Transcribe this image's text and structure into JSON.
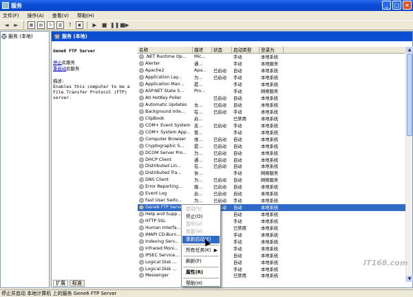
{
  "window": {
    "title": "服务"
  },
  "menubar": [
    "文件(F)",
    "操作(A)",
    "查看(V)",
    "帮助(H)"
  ],
  "tree": {
    "root_label": "服务 (本地)"
  },
  "panel": {
    "header": "服务 (本地)"
  },
  "description": {
    "service_name": "Gene6 FTP Server",
    "stop_link": "停止",
    "stop_suffix": "此服务",
    "restart_link": "重启动",
    "restart_suffix": "此服务",
    "desc_label": "描述:",
    "desc_text": "Enables this computer to be a File Transfer Protocol (FTP) server."
  },
  "table": {
    "columns": [
      "名称",
      "描述",
      "状态",
      "启动类型",
      "登录为"
    ],
    "rows": [
      [
        ".NET Runtime Op...",
        "Mic...",
        "",
        "手动",
        "本地系统"
      ],
      [
        "Alerter",
        "通...",
        "",
        "手动",
        "本地服务"
      ],
      [
        "Apache2",
        "Apa...",
        "已启动",
        "自动",
        "本地系统"
      ],
      [
        "Application Lay...",
        "为...",
        "已启动",
        "手动",
        "本地系统"
      ],
      [
        "Application Man...",
        "提...",
        "",
        "手动",
        "本地系统"
      ],
      [
        "ASP.NET State S...",
        "Pro...",
        "",
        "手动",
        "网络服务"
      ],
      [
        "Ati HotKey Poller",
        "",
        "已启动",
        "自动",
        "本地系统"
      ],
      [
        "Automatic Updates",
        "允...",
        "已启动",
        "自动",
        "本地系统"
      ],
      [
        "Background Inte...",
        "在...",
        "已启动",
        "手动",
        "本地系统"
      ],
      [
        "ClipBook",
        "启...",
        "",
        "已禁用",
        "本地系统"
      ],
      [
        "COM+ Event System",
        "支...",
        "已启动",
        "手动",
        "本地系统"
      ],
      [
        "COM+ System App...",
        "管...",
        "",
        "手动",
        "本地系统"
      ],
      [
        "Computer Browser",
        "维...",
        "已启动",
        "自动",
        "本地系统"
      ],
      [
        "Cryptographic S...",
        "提...",
        "已启动",
        "自动",
        "本地系统"
      ],
      [
        "DCOM Server Pro...",
        "为...",
        "已启动",
        "自动",
        "本地系统"
      ],
      [
        "DHCP Client",
        "通...",
        "已启动",
        "自动",
        "本地系统"
      ],
      [
        "Distributed Lin...",
        "在...",
        "已启动",
        "自动",
        "本地系统"
      ],
      [
        "Distributed Tra...",
        "协...",
        "",
        "手动",
        "网络服务"
      ],
      [
        "DNS Client",
        "为...",
        "已启动",
        "自动",
        "网络服务"
      ],
      [
        "Error Reporting...",
        "服...",
        "已启动",
        "自动",
        "本地系统"
      ],
      [
        "Event Log",
        "启...",
        "已启动",
        "自动",
        "本地系统"
      ],
      [
        "Fast User Switc...",
        "为...",
        "已启动",
        "手动",
        "本地系统"
      ],
      [
        "Gene6 FTP Server",
        "",
        "已启动",
        "自动",
        "本地系统"
      ],
      [
        "Help and Supp...",
        "",
        "",
        "自动",
        "本地系统"
      ],
      [
        "HTTP SSL",
        "",
        "",
        "手动",
        "本地系统"
      ],
      [
        "Human Interfa...",
        "",
        "",
        "已禁用",
        "本地系统"
      ],
      [
        "IMAPI CD-Burn...",
        "",
        "",
        "手动",
        "本地系统"
      ],
      [
        "Indexing Serv...",
        "",
        "",
        "手动",
        "本地系统"
      ],
      [
        "Infrared Moni...",
        "",
        "",
        "手动",
        "本地系统"
      ],
      [
        "IPSEC Service...",
        "",
        "",
        "自动",
        "本地系统"
      ],
      [
        "Logical Disk ...",
        "",
        "",
        "自动",
        "本地系统"
      ],
      [
        "Logical Disk ...",
        "",
        "",
        "手动",
        "本地系统"
      ],
      [
        "Messenger",
        "",
        "",
        "已禁用",
        "本地系统"
      ]
    ]
  },
  "tabs": [
    "扩展",
    "标准"
  ],
  "status_bar": "停止并启动 本地计算机 上的服务 Gene6 FTP Server",
  "context_menu": {
    "items": [
      {
        "label": "启动(S)",
        "disabled": true
      },
      {
        "label": "停止(O)",
        "disabled": false
      },
      {
        "label": "暂停(U)",
        "disabled": true
      },
      {
        "label": "恢复(M)",
        "disabled": true
      },
      {
        "label": "重新启动(E)",
        "disabled": false,
        "highlighted": true
      },
      {
        "sep": true
      },
      {
        "label": "所有任务(K)",
        "disabled": false,
        "submenu": true
      },
      {
        "sep": true
      },
      {
        "label": "刷新(F)",
        "disabled": false
      },
      {
        "sep": true
      },
      {
        "label": "属性(R)",
        "disabled": false,
        "bold": true
      },
      {
        "sep": true
      },
      {
        "label": "帮助(H)",
        "disabled": false
      }
    ]
  },
  "watermark": "IT168.com"
}
